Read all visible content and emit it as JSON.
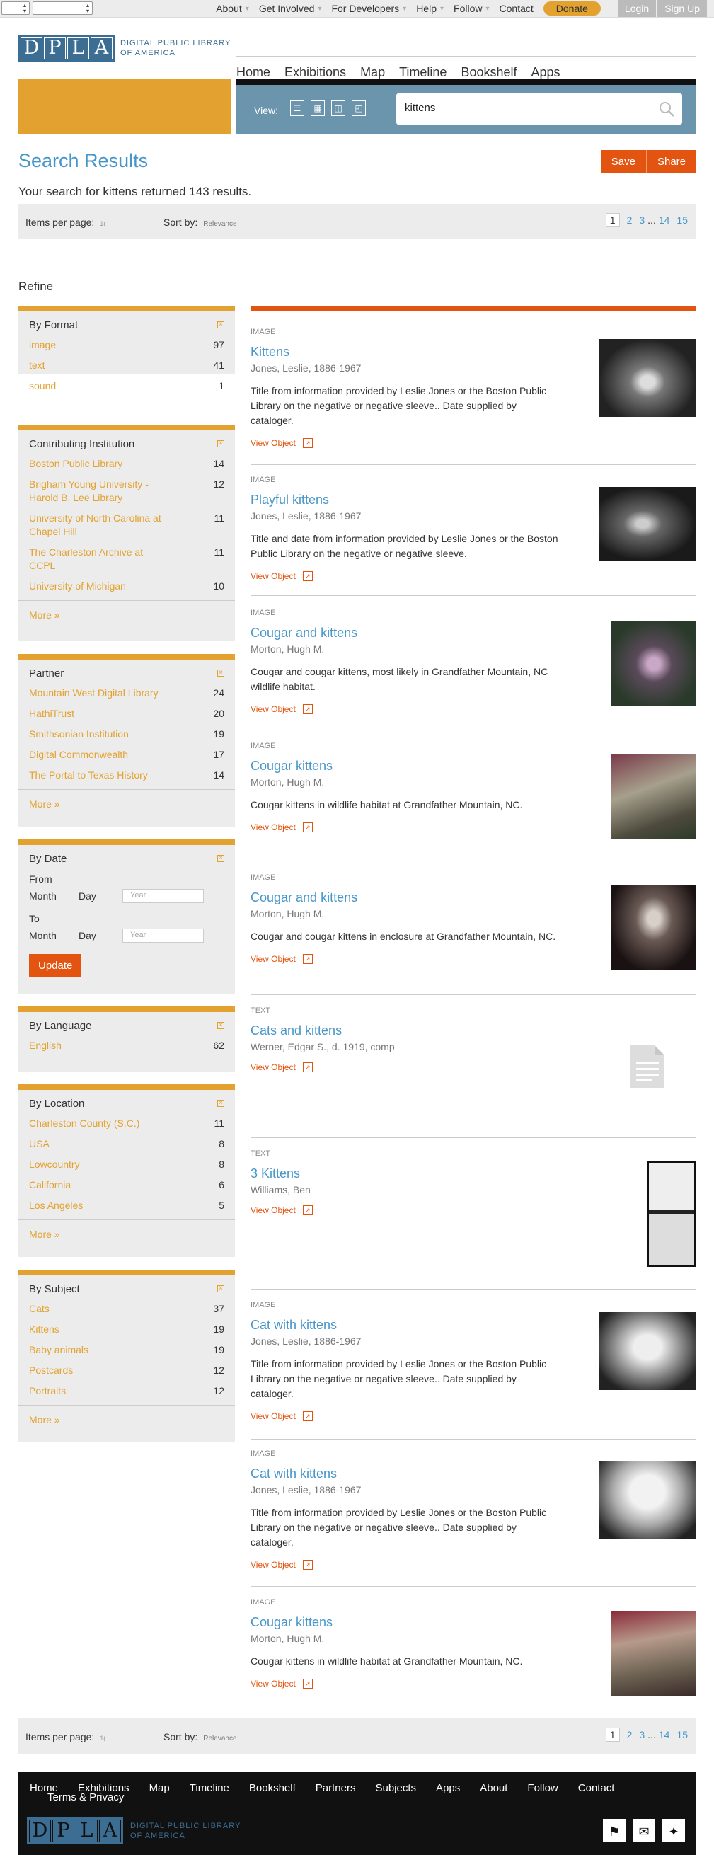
{
  "topnav": {
    "items": [
      "About",
      "Get Involved",
      "For Developers",
      "Help",
      "Follow",
      "Contact"
    ],
    "donate": "Donate",
    "login": "Login",
    "signup": "Sign Up"
  },
  "brand": {
    "letters": [
      "D",
      "P",
      "L",
      "A"
    ],
    "line1": "Digital Public Library",
    "line2": "of America"
  },
  "mainnav": [
    "Home",
    "Exhibitions",
    "Map",
    "Timeline",
    "Bookshelf",
    "Apps"
  ],
  "search": {
    "view_label": "View:",
    "query": "kittens"
  },
  "results": {
    "heading": "Search Results",
    "save": "Save",
    "share": "Share",
    "summary": "Your search for kittens returned 143 results."
  },
  "pager": {
    "items_label": "Items per page:",
    "items_value": "1(",
    "sort_label": "Sort by:",
    "sort_value": "Relevance",
    "pages": [
      "1",
      "2",
      "3",
      "...",
      "14",
      "15"
    ]
  },
  "refine": {
    "title": "Refine",
    "more": "More »",
    "facets": {
      "format": {
        "title": "By Format",
        "items": [
          {
            "label": "image",
            "count": "97"
          },
          {
            "label": "text",
            "count": "41"
          },
          {
            "label": "sound",
            "count": "1"
          }
        ]
      },
      "institution": {
        "title": "Contributing Institution",
        "items": [
          {
            "label": "Boston Public Library",
            "count": "14"
          },
          {
            "label": "Brigham Young University - Harold B. Lee Library",
            "count": "12"
          },
          {
            "label": "University of North Carolina at Chapel Hill",
            "count": "11"
          },
          {
            "label": "The Charleston Archive at CCPL",
            "count": "11"
          },
          {
            "label": "University of Michigan",
            "count": "10"
          }
        ]
      },
      "partner": {
        "title": "Partner",
        "items": [
          {
            "label": "Mountain West Digital Library",
            "count": "24"
          },
          {
            "label": "HathiTrust",
            "count": "20"
          },
          {
            "label": "Smithsonian Institution",
            "count": "19"
          },
          {
            "label": "Digital Commonwealth",
            "count": "17"
          },
          {
            "label": "The Portal to Texas History",
            "count": "14"
          }
        ]
      },
      "date": {
        "title": "By Date",
        "from": "From",
        "to": "To",
        "month": "Month",
        "day": "Day",
        "year_placeholder": "Year",
        "update": "Update"
      },
      "language": {
        "title": "By Language",
        "items": [
          {
            "label": "English",
            "count": "62"
          }
        ]
      },
      "location": {
        "title": "By Location",
        "items": [
          {
            "label": "Charleston County (S.C.)",
            "count": "11"
          },
          {
            "label": "USA",
            "count": "8"
          },
          {
            "label": "Lowcountry",
            "count": "8"
          },
          {
            "label": "California",
            "count": "6"
          },
          {
            "label": "Los Angeles",
            "count": "5"
          }
        ]
      },
      "subject": {
        "title": "By Subject",
        "items": [
          {
            "label": "Cats",
            "count": "37"
          },
          {
            "label": "Kittens",
            "count": "19"
          },
          {
            "label": "Baby animals",
            "count": "19"
          },
          {
            "label": "Postcards",
            "count": "12"
          },
          {
            "label": "Portraits",
            "count": "12"
          }
        ]
      }
    }
  },
  "items": [
    {
      "type": "IMAGE",
      "title": "Kittens",
      "creator": "Jones, Leslie, 1886-1967",
      "desc": "Title from information provided by Leslie Jones or the Boston Public Library on the negative or negative sleeve.. Date supplied by cataloger.",
      "view": "View Object"
    },
    {
      "type": "IMAGE",
      "title": "Playful kittens",
      "creator": "Jones, Leslie, 1886-1967",
      "desc": "Title and date from information provided by Leslie Jones or the Boston Public Library on the negative or negative sleeve.",
      "view": "View Object"
    },
    {
      "type": "IMAGE",
      "title": "Cougar and kittens",
      "creator": "Morton, Hugh M.",
      "desc": "Cougar and cougar kittens, most likely in Grandfather Mountain, NC wildlife habitat.",
      "view": "View Object"
    },
    {
      "type": "IMAGE",
      "title": "Cougar kittens",
      "creator": "Morton, Hugh M.",
      "desc": "Cougar kittens in wildlife habitat at Grandfather Mountain, NC.",
      "view": "View Object"
    },
    {
      "type": "IMAGE",
      "title": "Cougar and kittens",
      "creator": "Morton, Hugh M.",
      "desc": "Cougar and cougar kittens in enclosure at Grandfather Mountain, NC.",
      "view": "View Object"
    },
    {
      "type": "TEXT",
      "title": "Cats and kittens",
      "creator": "Werner, Edgar S., d. 1919, comp",
      "desc": "",
      "view": "View Object"
    },
    {
      "type": "TEXT",
      "title": "3 Kittens",
      "creator": "Williams, Ben",
      "desc": "",
      "view": "View Object"
    },
    {
      "type": "IMAGE",
      "title": "Cat with kittens",
      "creator": "Jones, Leslie, 1886-1967",
      "desc": "Title from information provided by Leslie Jones or the Boston Public Library on the negative or negative sleeve.. Date supplied by cataloger.",
      "view": "View Object"
    },
    {
      "type": "IMAGE",
      "title": "Cat with kittens",
      "creator": "Jones, Leslie, 1886-1967",
      "desc": "Title from information provided by Leslie Jones or the Boston Public Library on the negative or negative sleeve.. Date supplied by cataloger.",
      "view": "View Object"
    },
    {
      "type": "IMAGE",
      "title": "Cougar kittens",
      "creator": "Morton, Hugh M.",
      "desc": "Cougar kittens in wildlife habitat at Grandfather Mountain, NC.",
      "view": "View Object"
    }
  ],
  "footer": {
    "nav": [
      "Home",
      "Exhibitions",
      "Map",
      "Timeline",
      "Bookshelf",
      "Partners",
      "Subjects",
      "Apps",
      "About",
      "Follow",
      "Contact"
    ],
    "terms": "Terms & Privacy"
  }
}
